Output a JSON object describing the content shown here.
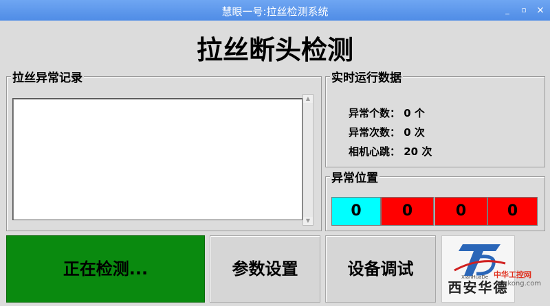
{
  "window": {
    "title": "慧眼一号:拉丝检测系统",
    "min_glyph": "_",
    "max_glyph": "▫",
    "close_glyph": "×"
  },
  "header": {
    "title": "拉丝断头检测"
  },
  "log_panel": {
    "title": "拉丝异常记录",
    "entries": []
  },
  "runtime_panel": {
    "title": "实时运行数据",
    "rows": [
      {
        "label": "异常个数：",
        "value": "0",
        "unit": "个"
      },
      {
        "label": "异常次数：",
        "value": "0",
        "unit": "次"
      },
      {
        "label": "相机心跳：",
        "value": "20",
        "unit": "次"
      }
    ]
  },
  "position_panel": {
    "title": "异常位置",
    "cells": [
      {
        "value": "0",
        "color": "#00ffff"
      },
      {
        "value": "0",
        "color": "#ff0000"
      },
      {
        "value": "0",
        "color": "#ff0000"
      },
      {
        "value": "0",
        "color": "#ff0000"
      }
    ]
  },
  "buttons": {
    "detect": "正在检测...",
    "params": "参数设置",
    "debug": "设备调试"
  },
  "colors": {
    "detect_active": "#0a8a0f",
    "titlebar": "#4f8ce6"
  },
  "logo": {
    "pinyin": "XianHuaDe",
    "chinese": "西安华德"
  },
  "watermark": {
    "line1": "中华工控网",
    "line2": "gkong.com"
  }
}
